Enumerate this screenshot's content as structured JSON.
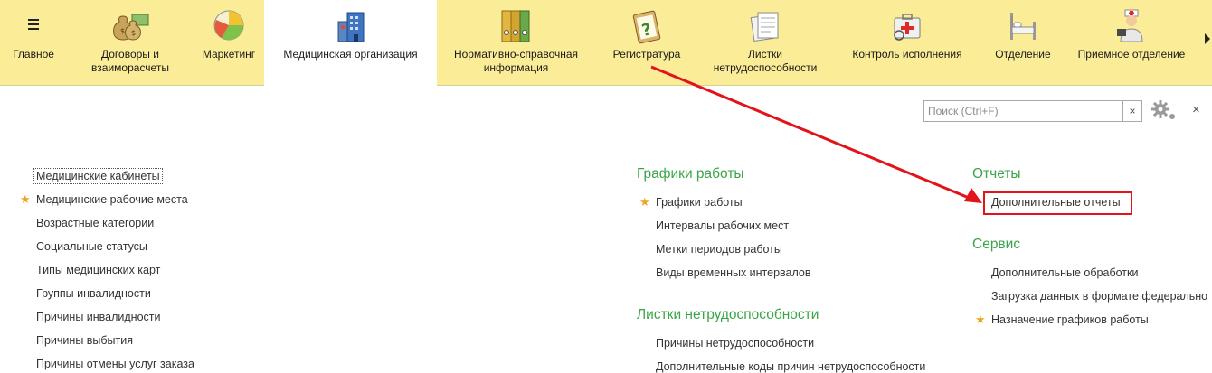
{
  "nav": {
    "tabs": [
      {
        "label": "Главное",
        "active": false,
        "icon": "home-icon"
      },
      {
        "label": "Договоры и\nвзаиморасчеты",
        "active": false,
        "icon": "money-bags-icon"
      },
      {
        "label": "Маркетинг",
        "active": false,
        "icon": "pie-chart-icon"
      },
      {
        "label": "Медицинская организация",
        "active": true,
        "icon": "building-icon"
      },
      {
        "label": "Нормативно-справочная\nинформация",
        "active": false,
        "icon": "binders-icon"
      },
      {
        "label": "Регистратура",
        "active": false,
        "icon": "clipboard-question-icon"
      },
      {
        "label": "Листки\nнетрудоспособности",
        "active": false,
        "icon": "documents-icon"
      },
      {
        "label": "Контроль исполнения",
        "active": false,
        "icon": "first-aid-icon"
      },
      {
        "label": "Отделение",
        "active": false,
        "icon": "hospital-bed-icon"
      },
      {
        "label": "Приемное отделение",
        "active": false,
        "icon": "nurse-icon"
      }
    ]
  },
  "search": {
    "placeholder": "Поиск (Ctrl+F)",
    "value": "",
    "clear_label": "×"
  },
  "close_label": "×",
  "col1": {
    "items": [
      {
        "label": "Медицинские кабинеты",
        "starred": false,
        "selected": true
      },
      {
        "label": "Медицинские рабочие места",
        "starred": true
      },
      {
        "label": "Возрастные категории",
        "starred": false
      },
      {
        "label": "Социальные статусы",
        "starred": false
      },
      {
        "label": "Типы медицинских карт",
        "starred": false
      },
      {
        "label": "Группы инвалидности",
        "starred": false
      },
      {
        "label": "Причины инвалидности",
        "starred": false
      },
      {
        "label": "Причины выбытия",
        "starred": false
      },
      {
        "label": "Причины отмены услуг заказа",
        "starred": false
      }
    ]
  },
  "col2": {
    "group1": {
      "title": "Графики работы",
      "items": [
        {
          "label": "Графики работы",
          "starred": true
        },
        {
          "label": "Интервалы рабочих мест",
          "starred": false
        },
        {
          "label": "Метки периодов работы",
          "starred": false
        },
        {
          "label": "Виды временных интервалов",
          "starred": false
        }
      ]
    },
    "group2": {
      "title": "Листки нетрудоспособности",
      "items": [
        {
          "label": "Причины нетрудоспособности",
          "starred": false
        },
        {
          "label": "Дополнительные коды причин нетрудоспособности",
          "starred": false
        }
      ]
    }
  },
  "col3": {
    "group1": {
      "title": "Отчеты",
      "items": [
        {
          "label": "Дополнительные отчеты",
          "starred": false,
          "highlighted": true
        }
      ]
    },
    "group2": {
      "title": "Сервис",
      "items": [
        {
          "label": "Дополнительные обработки",
          "starred": false
        },
        {
          "label": "Загрузка данных в формате федерально",
          "starred": false
        },
        {
          "label": "Назначение графиков работы",
          "starred": true
        }
      ]
    }
  },
  "colors": {
    "nav_bg": "#fbec97",
    "group_title": "#3aa548",
    "star": "#f0a420",
    "annotation": "#e3131b"
  }
}
